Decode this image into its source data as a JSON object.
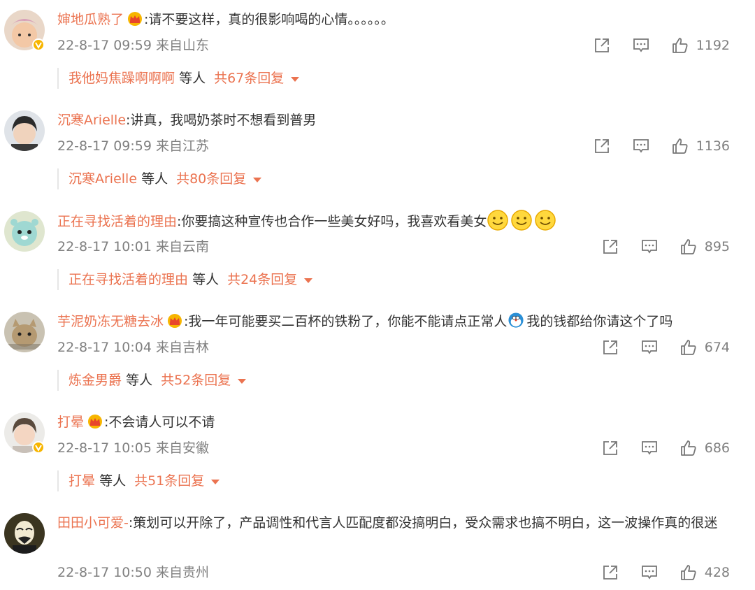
{
  "comments": [
    {
      "user": "婶地瓜熟了",
      "has_crown": true,
      "text": ":请不要这样，真的很影响喝的心情。。。。。。",
      "emojis": 0,
      "verified": true,
      "time": "22-8-17 09:59",
      "location": "来自山东",
      "likes": "1192",
      "reply_user": "我他妈焦躁啊啊啊",
      "reply_etc": "等人",
      "reply_total": "共67条回复"
    },
    {
      "user": "沉寒Arielle",
      "has_crown": false,
      "text": ":讲真，我喝奶茶时不想看到普男",
      "emojis": 0,
      "verified": false,
      "time": "22-8-17 09:59",
      "location": "来自江苏",
      "likes": "1136",
      "reply_user": "沉寒Arielle",
      "reply_etc": "等人",
      "reply_total": "共80条回复"
    },
    {
      "user": "正在寻找活着的理由",
      "has_crown": false,
      "text": ":你要搞这种宣传也合作一些美女好吗，我喜欢看美女",
      "emojis": 3,
      "verified": false,
      "time": "22-8-17 10:01",
      "location": "来自云南",
      "likes": "895",
      "reply_user": "正在寻找活着的理由",
      "reply_etc": "等人",
      "reply_total": "共24条回复"
    },
    {
      "user": "芋泥奶冻无糖去冰",
      "has_crown": true,
      "text_a": ":我一年可能要买二百杯的铁粉了，你能不能请点正常人",
      "text_b": "我的钱都给你请这个了吗",
      "emojis": 0,
      "verified": false,
      "time": "22-8-17 10:04",
      "location": "来自吉林",
      "likes": "674",
      "reply_user": "炼金男爵",
      "reply_etc": "等人",
      "reply_total": "共52条回复"
    },
    {
      "user": "打晕",
      "has_crown": true,
      "text": ":不会请人可以不请",
      "emojis": 0,
      "verified": true,
      "time": "22-8-17 10:05",
      "location": "来自安徽",
      "likes": "686",
      "reply_user": "打晕",
      "reply_etc": "等人",
      "reply_total": "共51条回复"
    },
    {
      "user": "田田小可爱-",
      "has_crown": false,
      "text": ":策划可以开除了，产品调性和代言人匹配度都没搞明白，受众需求也搞不明白，这一波操作真的很迷",
      "emojis": 0,
      "verified": false,
      "time": "22-8-17 10:50",
      "location": "来自贵州",
      "likes": "428"
    }
  ],
  "icons": {
    "share": "share-icon",
    "comment": "comment-icon",
    "like": "thumbs-up-icon",
    "crown": "crown-icon",
    "smile": "smile-emoji-icon"
  },
  "colors": {
    "username": "#eb7350",
    "meta": "#808080",
    "text": "#333333",
    "crown": "#f7b500"
  }
}
